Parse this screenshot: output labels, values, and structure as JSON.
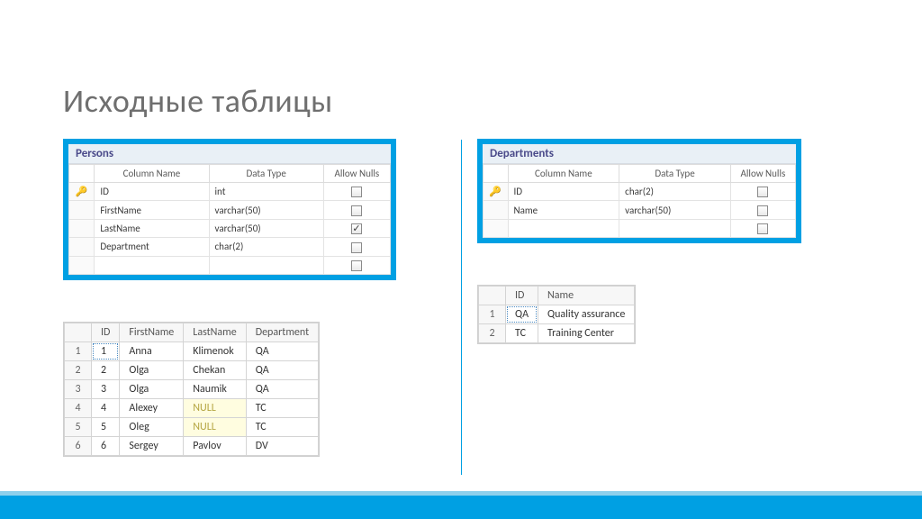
{
  "title": "Исходные таблицы",
  "schema_headers": {
    "col": "Column Name",
    "type": "Data Type",
    "null": "Allow Nulls"
  },
  "persons": {
    "title": "Persons",
    "cols": [
      {
        "key": true,
        "name": "ID",
        "type": "int",
        "null": false
      },
      {
        "key": false,
        "name": "FirstName",
        "type": "varchar(50)",
        "null": false
      },
      {
        "key": false,
        "name": "LastName",
        "type": "varchar(50)",
        "null": true
      },
      {
        "key": false,
        "name": "Department",
        "type": "char(2)",
        "null": false
      },
      {
        "key": false,
        "name": "",
        "type": "",
        "null": false
      }
    ],
    "data_headers": [
      "ID",
      "FirstName",
      "LastName",
      "Department"
    ],
    "rows": [
      {
        "n": "1",
        "id": "1",
        "fn": "Anna",
        "ln": "Klimenok",
        "dep": "QA",
        "sel": true
      },
      {
        "n": "2",
        "id": "2",
        "fn": "Olga",
        "ln": "Chekan",
        "dep": "QA"
      },
      {
        "n": "3",
        "id": "3",
        "fn": "Olga",
        "ln": "Naumik",
        "dep": "QA"
      },
      {
        "n": "4",
        "id": "4",
        "fn": "Alexey",
        "ln": "NULL",
        "dep": "TC",
        "ln_null": true
      },
      {
        "n": "5",
        "id": "5",
        "fn": "Oleg",
        "ln": "NULL",
        "dep": "TC",
        "ln_null": true
      },
      {
        "n": "6",
        "id": "6",
        "fn": "Sergey",
        "ln": "Pavlov",
        "dep": "DV"
      }
    ]
  },
  "departments": {
    "title": "Departments",
    "cols": [
      {
        "key": true,
        "name": "ID",
        "type": "char(2)",
        "null": false
      },
      {
        "key": false,
        "name": "Name",
        "type": "varchar(50)",
        "null": false
      },
      {
        "key": false,
        "name": "",
        "type": "",
        "null": false
      }
    ],
    "data_headers": [
      "ID",
      "Name"
    ],
    "rows": [
      {
        "n": "1",
        "id": "QA",
        "name": "Quality assurance",
        "sel": true
      },
      {
        "n": "2",
        "id": "TC",
        "name": "Training Center"
      }
    ]
  }
}
